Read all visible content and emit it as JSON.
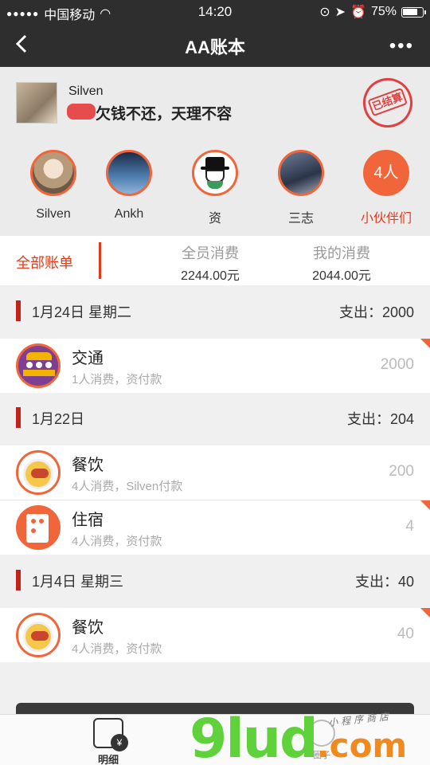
{
  "status_bar": {
    "carrier": "中国移动",
    "time": "14:20",
    "battery": "75%"
  },
  "nav": {
    "title": "AA账本",
    "back_icon": "chevron-left-icon",
    "more_icon": "more-dots-icon"
  },
  "user": {
    "name": "Silven",
    "motto": "欠钱不还，天理不容",
    "stamp": "已结算"
  },
  "members": [
    {
      "name": "Silven"
    },
    {
      "name": "Ankh"
    },
    {
      "name": "资"
    },
    {
      "name": "三志"
    }
  ],
  "member_count": {
    "badge": "4人",
    "label": "小伙伴们"
  },
  "summary": {
    "tab_label": "全部账单",
    "total_label": "全员消费",
    "total_value": "2244.00元",
    "mine_label": "我的消费",
    "mine_value": "2044.00元"
  },
  "days": [
    {
      "date": "1月24日  星期二",
      "spend": "支出：2000",
      "items": [
        {
          "category": "交通",
          "desc": "1人消费，资付款",
          "amount": "2000",
          "icon": "bus-icon",
          "flag": true
        }
      ]
    },
    {
      "date": "1月22日",
      "spend": "支出：204",
      "items": [
        {
          "category": "餐饮",
          "desc": "4人消费，Silven付款",
          "amount": "200",
          "icon": "food-icon",
          "flag": false
        },
        {
          "category": "住宿",
          "desc": "4人消费，资付款",
          "amount": "4",
          "icon": "hotel-icon",
          "flag": true
        }
      ]
    },
    {
      "date": "1月4日  星期三",
      "spend": "支出：40",
      "items": [
        {
          "category": "餐饮",
          "desc": "4人消费，资付款",
          "amount": "40",
          "icon": "food-icon",
          "flag": true
        }
      ]
    }
  ],
  "tabbar": {
    "detail_label": "明细",
    "detail_badge": "¥",
    "circle_label": "圈子"
  },
  "watermark": {
    "brand": "9lud",
    "suffix": ".com",
    "tagline": "小程序商店"
  },
  "colors": {
    "accent": "#f0663a",
    "red": "#e53a1a",
    "header_bg": "#2e2e2e"
  }
}
